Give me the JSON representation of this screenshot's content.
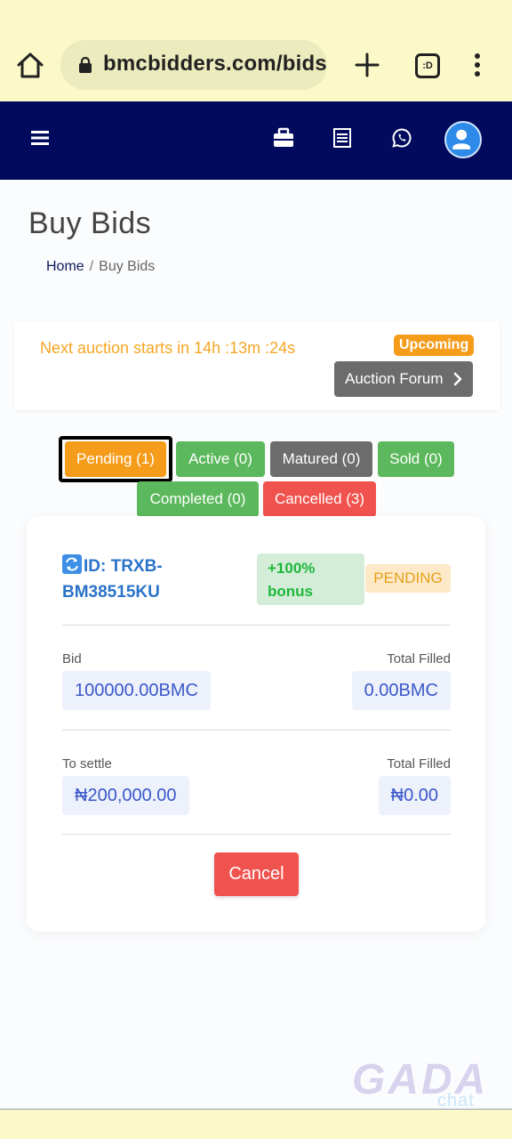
{
  "browser": {
    "url": "bmcbidders.com/bids",
    "tabs_count": ":D"
  },
  "nav": {
    "icons": [
      "home-icon",
      "lock-icon",
      "plus-icon",
      "tabs-icon",
      "more-vert-icon",
      "hamburger-icon",
      "briefcase-icon",
      "ledger-icon",
      "whatsapp-icon",
      "user-avatar-icon"
    ]
  },
  "page": {
    "title": "Buy Bids",
    "breadcrumb": {
      "home": "Home",
      "separator": "/",
      "current": "Buy Bids"
    }
  },
  "auction": {
    "countdown": "Next auction starts in 14h :13m :24s",
    "badge": "Upcoming",
    "forum_button": "Auction Forum"
  },
  "filters": {
    "pending": "Pending (1)",
    "active": "Active (0)",
    "matured": "Matured (0)",
    "sold": "Sold (0)",
    "completed": "Completed (0)",
    "cancelled": "Cancelled (3)"
  },
  "bid": {
    "id_text": "ID: TRXB-BM38515KU",
    "bonus": "+100% bonus",
    "status": "PENDING",
    "bid_label": "Bid",
    "bid_value": "100000.00BMC",
    "filled_label": "Total Filled",
    "filled_value": "0.00BMC",
    "settle_label": "To settle",
    "settle_value": "₦200,000.00",
    "filled_label_2": "Total Filled",
    "filled_value_2": "₦0.00",
    "cancel_button": "Cancel"
  },
  "watermark": {
    "main": "GADA",
    "sub": "chat"
  },
  "colors": {
    "nav_bg": "#020a5e",
    "browser_bg": "#fcf9c8",
    "orange": "#f59c1a",
    "green": "#5cb85c",
    "gray": "#6c6c6c",
    "red": "#f0524e",
    "blue_text": "#2a73c8"
  }
}
